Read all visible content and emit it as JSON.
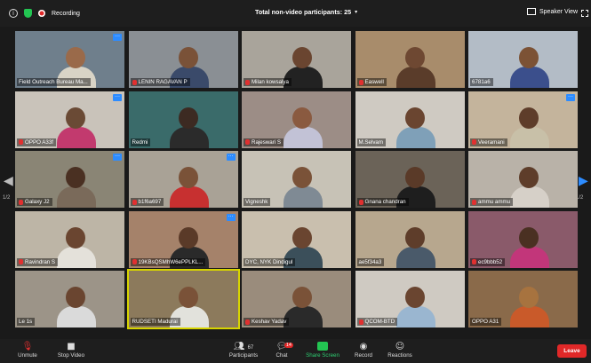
{
  "topbar": {
    "recording_label": "Recording",
    "title": "Total non-video participants: 25",
    "view_label": "Speaker View"
  },
  "pages": {
    "left": "1/2",
    "right": "1/2"
  },
  "tiles": [
    {
      "name": "Field Outreach Bureau Ma...",
      "muted": false,
      "more": true,
      "bg": "#6f7f8c",
      "skin": "#9a6a4a",
      "shirt": "#d9d4c6"
    },
    {
      "name": "LENIN RAGAVAN P",
      "muted": true,
      "more": false,
      "bg": "#8a8f94",
      "skin": "#7a5238",
      "shirt": "#3a4a6a"
    },
    {
      "name": "Milan kowsalya",
      "muted": true,
      "more": false,
      "bg": "#a9a49b",
      "skin": "#6a4530",
      "shirt": "#222"
    },
    {
      "name": "Easwell",
      "muted": true,
      "more": false,
      "bg": "#a88c6b",
      "skin": "#6e4832",
      "shirt": "#5a3c2a"
    },
    {
      "name": "6781a6",
      "muted": false,
      "more": false,
      "bg": "#b3bcc6",
      "skin": "#7c5235",
      "shirt": "#3b4f8c"
    },
    {
      "name": "OPPO A33f",
      "muted": true,
      "more": true,
      "bg": "#c9c3ba",
      "skin": "#6a4a35",
      "shirt": "#c23a6e"
    },
    {
      "name": "Redmi",
      "muted": false,
      "more": false,
      "bg": "#3a6b6a",
      "skin": "#3c2a22",
      "shirt": "#2b2b2b"
    },
    {
      "name": "Rajeswari S",
      "muted": true,
      "more": false,
      "bg": "#9c8d86",
      "skin": "#8a5a40",
      "shirt": "#c2c2d6"
    },
    {
      "name": "M.Selvam",
      "muted": false,
      "more": false,
      "bg": "#cfcac2",
      "skin": "#6a4530",
      "shirt": "#7fa0b8"
    },
    {
      "name": "Veeramani",
      "muted": true,
      "more": true,
      "bg": "#c4b49c",
      "skin": "#5e3d2a",
      "shirt": "#c8c0a8"
    },
    {
      "name": "Galaxy J2",
      "muted": true,
      "more": true,
      "bg": "#8a8575",
      "skin": "#4a3022",
      "shirt": "#7a6a5a"
    },
    {
      "name": "b1f6a697",
      "muted": true,
      "more": true,
      "bg": "#a9a296",
      "skin": "#7a5238",
      "shirt": "#c73030"
    },
    {
      "name": "Vigneshk",
      "muted": false,
      "more": false,
      "bg": "#c7c2b6",
      "skin": "#7a5238",
      "shirt": "#7f8a94"
    },
    {
      "name": "Gnana chandran",
      "muted": true,
      "more": false,
      "bg": "#6b6358",
      "skin": "#5a3a28",
      "shirt": "#1e1e1e"
    },
    {
      "name": "ammu ammu",
      "muted": true,
      "more": false,
      "bg": "#b9b2a8",
      "skin": "#5e3d2a",
      "shirt": "#d6d0c8"
    },
    {
      "name": "Ravindran S",
      "muted": true,
      "more": false,
      "bg": "#bdb5a6",
      "skin": "#6a4530",
      "shirt": "#e4e1da"
    },
    {
      "name": "19KBsQSMhW6ePPLKL...",
      "muted": true,
      "more": true,
      "bg": "#a5826a",
      "skin": "#5a3a28",
      "shirt": "#2a2a2a"
    },
    {
      "name": "DYC, NYK Dindigul",
      "muted": false,
      "more": false,
      "bg": "#c9bfae",
      "skin": "#6a4530",
      "shirt": "#3b4f5a"
    },
    {
      "name": "ae5f34a3",
      "muted": false,
      "more": false,
      "bg": "#b7a78e",
      "skin": "#5e3d2a",
      "shirt": "#4a5a6a"
    },
    {
      "name": "ec9bbb52",
      "muted": true,
      "more": false,
      "bg": "#8a5a6a",
      "skin": "#4a3022",
      "shirt": "#c2367a"
    },
    {
      "name": "Le 1s",
      "muted": false,
      "more": false,
      "bg": "#9c9488",
      "skin": "#6a4530",
      "shirt": "#dadada"
    },
    {
      "name": "RUDSETI Madurai",
      "muted": false,
      "more": false,
      "bg": "#8c7a5c",
      "skin": "#7a5238",
      "shirt": "#e2e2dc",
      "active": true
    },
    {
      "name": "Keshav Yadav",
      "muted": true,
      "more": false,
      "bg": "#9a8c7c",
      "skin": "#7a5238",
      "shirt": "#2a2a2a"
    },
    {
      "name": "QCOM-BTD",
      "muted": true,
      "more": false,
      "bg": "#cfcac2",
      "skin": "#6a4530",
      "shirt": "#9ab6d0"
    },
    {
      "name": "OPPO A31",
      "muted": false,
      "more": false,
      "bg": "#8a6a4a",
      "skin": "#a7733f",
      "shirt": "#c95a2a"
    }
  ],
  "bottom": {
    "unmute": "Unmute",
    "stop_video": "Stop Video",
    "participants_count": "67",
    "participants": "Participants",
    "chat_badge": "14",
    "chat": "Chat",
    "share_screen": "Share Screen",
    "record": "Record",
    "reactions": "Reactions",
    "leave": "Leave"
  }
}
